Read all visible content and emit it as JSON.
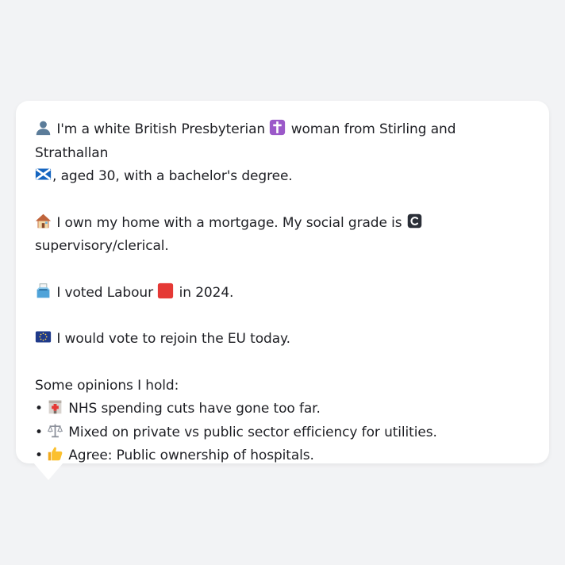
{
  "message": {
    "identity": {
      "part1": "I'm a white British Presbyterian",
      "part2": "woman from Stirling and Strathallan",
      "part3": ", aged 30, with a bachelor's degree."
    },
    "home": {
      "part1": "I own my home with a mortgage. My social grade is",
      "part2": "supervisory/clerical."
    },
    "vote": {
      "part1": "I voted Labour",
      "part2": "in 2024."
    },
    "eu": {
      "text": "I would vote to rejoin the EU today."
    },
    "opinions_heading": "Some opinions I hold:",
    "opinions": [
      {
        "bullet": "•",
        "icon": "hospital-icon",
        "text": "NHS spending cuts have gone too far."
      },
      {
        "bullet": "•",
        "icon": "scales-icon",
        "text": "Mixed on private vs public sector efficiency for utilities."
      },
      {
        "bullet": "•",
        "icon": "thumbs-up-icon",
        "text": "Agree: Public ownership of hospitals."
      }
    ]
  },
  "icons": {
    "person": "person-silhouette-icon",
    "religion": "latin-cross-icon",
    "region_flag": "scotland-flag-icon",
    "home": "house-icon",
    "grade": "letter-c-icon",
    "ballot": "ballot-box-icon",
    "party": "red-square-icon",
    "eu_flag": "eu-flag-icon"
  },
  "colors": {
    "background": "#f2f3f5",
    "bubble": "#ffffff",
    "text": "#1e1f24",
    "labour_red": "#e53935",
    "cross_purple": "#9b59c9",
    "eu_blue": "#1f3a8a"
  }
}
